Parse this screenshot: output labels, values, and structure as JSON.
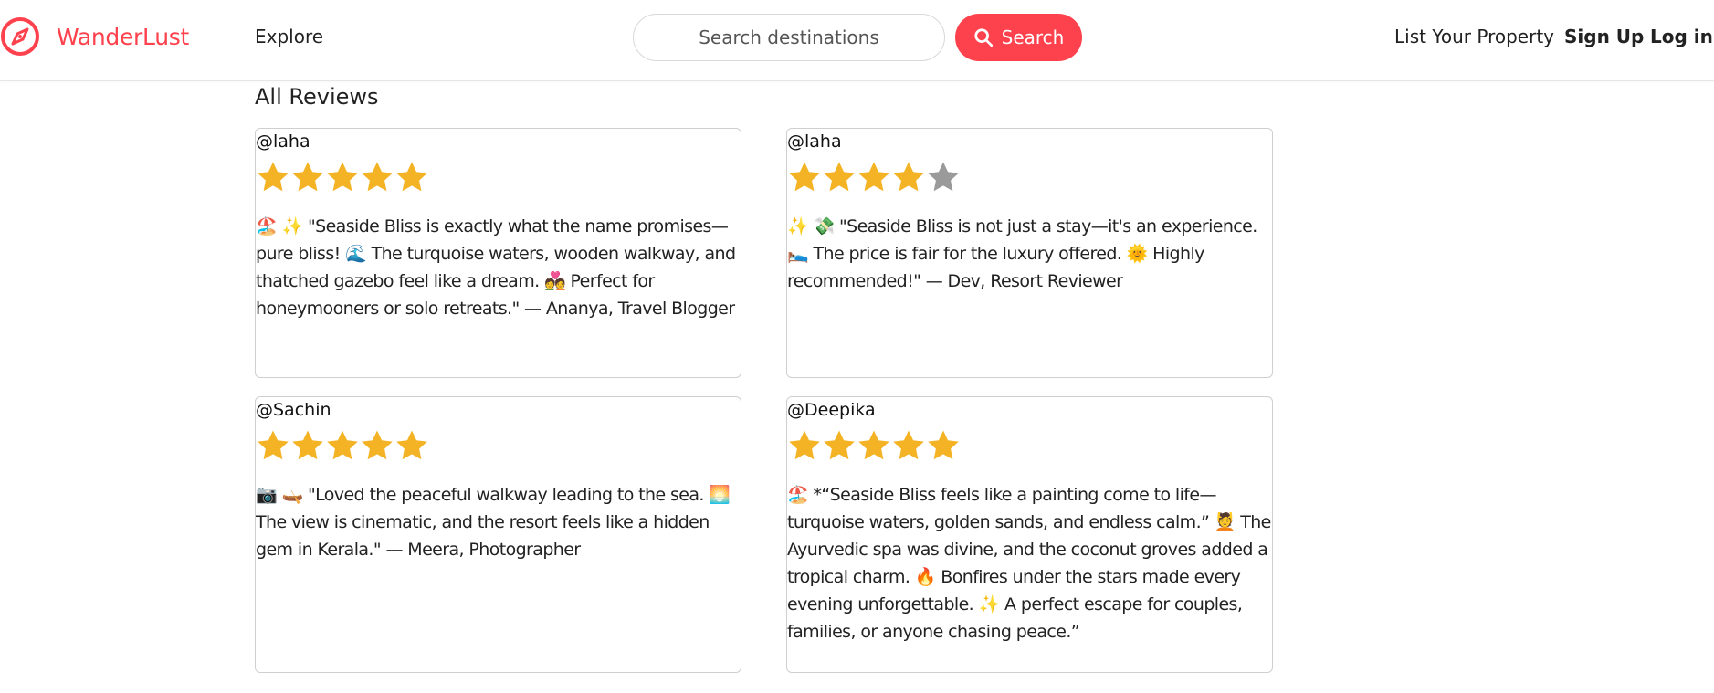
{
  "navbar": {
    "brand": "WanderLust",
    "explore": "Explore",
    "search_placeholder": "Search destinations",
    "search_button": "Search",
    "list_property": "List Your Property",
    "sign_up": "Sign Up",
    "log_in": "Log in"
  },
  "reviews_section": {
    "title": "All Reviews",
    "reviews": [
      {
        "author": "@laha",
        "rating": 5,
        "max_rating": 5,
        "text": "🏖️ ✨ \"Seaside Bliss is exactly what the name promises—pure bliss! 🌊 The turquoise waters, wooden walkway, and thatched gazebo feel like a dream. 💑 Perfect for honeymooners or solo retreats.\" — Ananya, Travel Blogger"
      },
      {
        "author": "@laha",
        "rating": 4,
        "max_rating": 5,
        "text": "✨ 💸 \"Seaside Bliss is not just a stay—it's an experience. 🛌 The price is fair for the luxury offered. 🌞 Highly recommended!\" — Dev, Resort Reviewer"
      },
      {
        "author": "@Sachin",
        "rating": 5,
        "max_rating": 5,
        "text": "📷 🛶 \"Loved the peaceful walkway leading to the sea. 🌅 The view is cinematic, and the resort feels like a hidden gem in Kerala.\" — Meera, Photographer"
      },
      {
        "author": "@Deepika",
        "rating": 5,
        "max_rating": 5,
        "text": "🏖️ *“Seaside Bliss feels like a painting come to life—turquoise waters, golden sands, and endless calm.” 💆 The Ayurvedic spa was divine, and the coconut groves added a tropical charm. 🔥 Bonfires under the stars made every evening unforgettable. ✨ A perfect escape for couples, families, or anyone chasing peace.”"
      }
    ]
  },
  "colors": {
    "brand": "#fe424d",
    "star_filled": "#f4b324",
    "star_empty": "#9a9a9a",
    "card_border": "#cfcfcf"
  },
  "icons": {
    "brand_logo": "compass-icon",
    "search_button_icon": "magnifier-icon",
    "rating_star": "star-icon"
  }
}
